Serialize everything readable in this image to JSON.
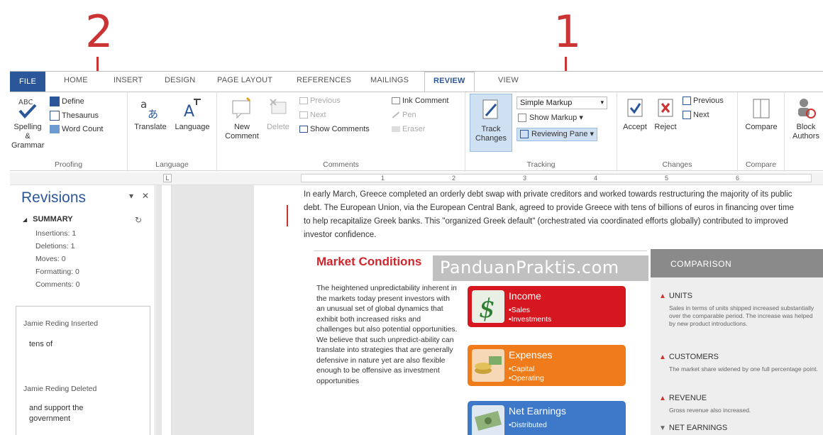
{
  "callouts": {
    "one": "1",
    "two": "2"
  },
  "tabs": [
    "FILE",
    "HOME",
    "INSERT",
    "DESIGN",
    "PAGE LAYOUT",
    "REFERENCES",
    "MAILINGS",
    "REVIEW",
    "VIEW"
  ],
  "ribbon": {
    "proofing": {
      "spelling": "Spelling &",
      "spelling2": "Grammar",
      "define": "Define",
      "thesaurus": "Thesaurus",
      "word_count": "Word Count",
      "label": "Proofing"
    },
    "language": {
      "translate": "Translate",
      "language": "Language",
      "label": "Language"
    },
    "comments": {
      "new": "New",
      "new2": "Comment",
      "delete": "Delete",
      "previous": "Previous",
      "next": "Next",
      "show_comments": "Show Comments",
      "label": "Comments"
    },
    "ink": {
      "ink_comment": "Ink Comment",
      "pen": "Pen",
      "eraser": "Eraser"
    },
    "tracking": {
      "track": "Track",
      "track2": "Changes",
      "markup": "Simple Markup",
      "show_markup": "Show Markup",
      "reviewing_pane": "Reviewing Pane",
      "label": "Tracking"
    },
    "changes": {
      "accept": "Accept",
      "reject": "Reject",
      "previous": "Previous",
      "next": "Next",
      "label": "Changes"
    },
    "compare": {
      "compare": "Compare",
      "label": "Compare"
    },
    "protect": {
      "block": "Block",
      "authors": "Authors"
    }
  },
  "ruler": {
    "marks": [
      "1",
      "2",
      "3",
      "4",
      "5",
      "6"
    ],
    "indent": "L"
  },
  "pane": {
    "title": "Revisions",
    "summary": "SUMMARY",
    "insertions": "Insertions: 1",
    "deletions": "Deletions: 1",
    "moves": "Moves: 0",
    "formatting": "Formatting: 0",
    "comments": "Comments: 0",
    "rev1_author": "Jamie Reding Inserted",
    "rev1_text": "tens of",
    "rev2_author": "Jamie Reding Deleted",
    "rev2_text": "and support the government"
  },
  "doc": {
    "paragraph": "In early March, Greece completed an orderly debt swap with private creditors and worked towards restructuring the majority of its public debt. The European Union, via the European Central Bank, agreed to provide Greece with tens of billions of euros in financing over time to help recapitalize Greek banks. This \"organized Greek default\" (orchestrated via coordinated efforts globally) contributed to improved investor confidence.",
    "mc_title": "Market Conditions",
    "mc_body": "The heightened unpredictability inherent in the markets today present investors with an unusual set of global dynamics that exhibit both increased risks and challenges but also potential opportunities. We believe that such unpredict-ability can translate into strategies that are generally defensive in nature yet are also flexible enough to be offensive as investment opportunities"
  },
  "cards": [
    {
      "title": "Income",
      "items": [
        "•Sales",
        "•Investments"
      ],
      "color": "#d7171f"
    },
    {
      "title": "Expenses",
      "items": [
        "•Capital",
        "•Operating"
      ],
      "color": "#f07b1a"
    },
    {
      "title": "Net Earnings",
      "items": [
        "•Distributed"
      ],
      "color": "#3d78c9"
    }
  ],
  "comparison": {
    "header": "COMPARISON",
    "units_h": "UNITS",
    "units_t": "Sales in terms of units shipped increased substantially over the comparable period. The increase was helped by new product introductions.",
    "customers_h": "CUSTOMERS",
    "customers_t": "The market share widened by one full percentage point.",
    "revenue_h": "REVENUE",
    "revenue_t": "Gross revenue also increased.",
    "net_h": "NET EARNINGS"
  },
  "watermark": "PanduanPraktis.com"
}
